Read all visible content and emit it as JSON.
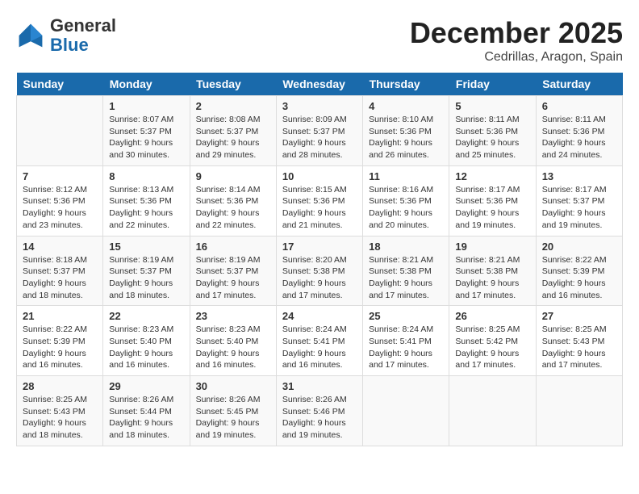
{
  "header": {
    "logo_general": "General",
    "logo_blue": "Blue",
    "month_title": "December 2025",
    "location": "Cedrillas, Aragon, Spain"
  },
  "days_of_week": [
    "Sunday",
    "Monday",
    "Tuesday",
    "Wednesday",
    "Thursday",
    "Friday",
    "Saturday"
  ],
  "weeks": [
    [
      {
        "day": "",
        "content": ""
      },
      {
        "day": "1",
        "content": "Sunrise: 8:07 AM\nSunset: 5:37 PM\nDaylight: 9 hours\nand 30 minutes."
      },
      {
        "day": "2",
        "content": "Sunrise: 8:08 AM\nSunset: 5:37 PM\nDaylight: 9 hours\nand 29 minutes."
      },
      {
        "day": "3",
        "content": "Sunrise: 8:09 AM\nSunset: 5:37 PM\nDaylight: 9 hours\nand 28 minutes."
      },
      {
        "day": "4",
        "content": "Sunrise: 8:10 AM\nSunset: 5:36 PM\nDaylight: 9 hours\nand 26 minutes."
      },
      {
        "day": "5",
        "content": "Sunrise: 8:11 AM\nSunset: 5:36 PM\nDaylight: 9 hours\nand 25 minutes."
      },
      {
        "day": "6",
        "content": "Sunrise: 8:11 AM\nSunset: 5:36 PM\nDaylight: 9 hours\nand 24 minutes."
      }
    ],
    [
      {
        "day": "7",
        "content": "Sunrise: 8:12 AM\nSunset: 5:36 PM\nDaylight: 9 hours\nand 23 minutes."
      },
      {
        "day": "8",
        "content": "Sunrise: 8:13 AM\nSunset: 5:36 PM\nDaylight: 9 hours\nand 22 minutes."
      },
      {
        "day": "9",
        "content": "Sunrise: 8:14 AM\nSunset: 5:36 PM\nDaylight: 9 hours\nand 22 minutes."
      },
      {
        "day": "10",
        "content": "Sunrise: 8:15 AM\nSunset: 5:36 PM\nDaylight: 9 hours\nand 21 minutes."
      },
      {
        "day": "11",
        "content": "Sunrise: 8:16 AM\nSunset: 5:36 PM\nDaylight: 9 hours\nand 20 minutes."
      },
      {
        "day": "12",
        "content": "Sunrise: 8:17 AM\nSunset: 5:36 PM\nDaylight: 9 hours\nand 19 minutes."
      },
      {
        "day": "13",
        "content": "Sunrise: 8:17 AM\nSunset: 5:37 PM\nDaylight: 9 hours\nand 19 minutes."
      }
    ],
    [
      {
        "day": "14",
        "content": "Sunrise: 8:18 AM\nSunset: 5:37 PM\nDaylight: 9 hours\nand 18 minutes."
      },
      {
        "day": "15",
        "content": "Sunrise: 8:19 AM\nSunset: 5:37 PM\nDaylight: 9 hours\nand 18 minutes."
      },
      {
        "day": "16",
        "content": "Sunrise: 8:19 AM\nSunset: 5:37 PM\nDaylight: 9 hours\nand 17 minutes."
      },
      {
        "day": "17",
        "content": "Sunrise: 8:20 AM\nSunset: 5:38 PM\nDaylight: 9 hours\nand 17 minutes."
      },
      {
        "day": "18",
        "content": "Sunrise: 8:21 AM\nSunset: 5:38 PM\nDaylight: 9 hours\nand 17 minutes."
      },
      {
        "day": "19",
        "content": "Sunrise: 8:21 AM\nSunset: 5:38 PM\nDaylight: 9 hours\nand 17 minutes."
      },
      {
        "day": "20",
        "content": "Sunrise: 8:22 AM\nSunset: 5:39 PM\nDaylight: 9 hours\nand 16 minutes."
      }
    ],
    [
      {
        "day": "21",
        "content": "Sunrise: 8:22 AM\nSunset: 5:39 PM\nDaylight: 9 hours\nand 16 minutes."
      },
      {
        "day": "22",
        "content": "Sunrise: 8:23 AM\nSunset: 5:40 PM\nDaylight: 9 hours\nand 16 minutes."
      },
      {
        "day": "23",
        "content": "Sunrise: 8:23 AM\nSunset: 5:40 PM\nDaylight: 9 hours\nand 16 minutes."
      },
      {
        "day": "24",
        "content": "Sunrise: 8:24 AM\nSunset: 5:41 PM\nDaylight: 9 hours\nand 16 minutes."
      },
      {
        "day": "25",
        "content": "Sunrise: 8:24 AM\nSunset: 5:41 PM\nDaylight: 9 hours\nand 17 minutes."
      },
      {
        "day": "26",
        "content": "Sunrise: 8:25 AM\nSunset: 5:42 PM\nDaylight: 9 hours\nand 17 minutes."
      },
      {
        "day": "27",
        "content": "Sunrise: 8:25 AM\nSunset: 5:43 PM\nDaylight: 9 hours\nand 17 minutes."
      }
    ],
    [
      {
        "day": "28",
        "content": "Sunrise: 8:25 AM\nSunset: 5:43 PM\nDaylight: 9 hours\nand 18 minutes."
      },
      {
        "day": "29",
        "content": "Sunrise: 8:26 AM\nSunset: 5:44 PM\nDaylight: 9 hours\nand 18 minutes."
      },
      {
        "day": "30",
        "content": "Sunrise: 8:26 AM\nSunset: 5:45 PM\nDaylight: 9 hours\nand 19 minutes."
      },
      {
        "day": "31",
        "content": "Sunrise: 8:26 AM\nSunset: 5:46 PM\nDaylight: 9 hours\nand 19 minutes."
      },
      {
        "day": "",
        "content": ""
      },
      {
        "day": "",
        "content": ""
      },
      {
        "day": "",
        "content": ""
      }
    ]
  ]
}
